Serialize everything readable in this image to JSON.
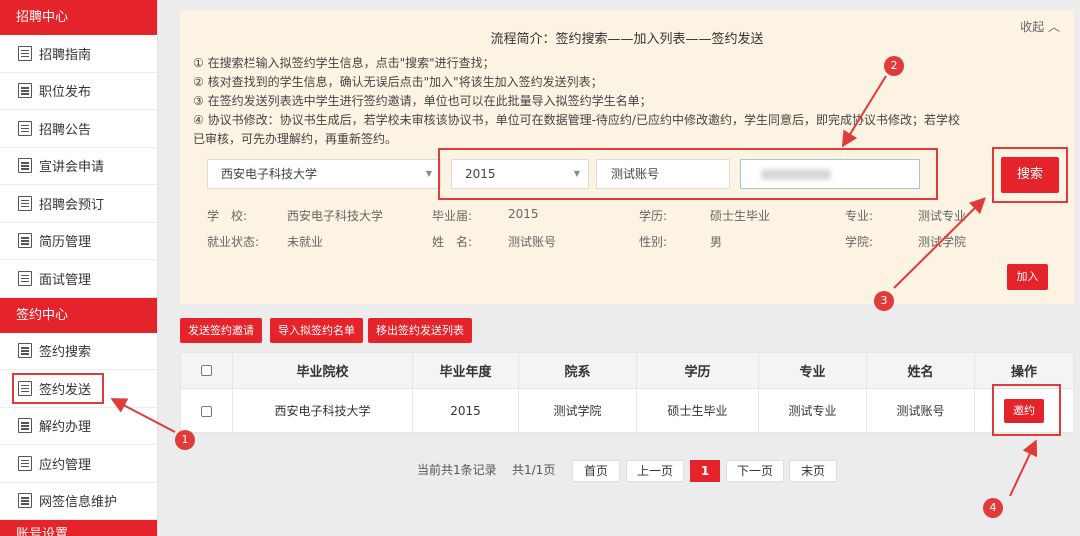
{
  "sidebar": {
    "section1": "招聘中心",
    "items1": [
      "招聘指南",
      "职位发布",
      "招聘公告",
      "宣讲会申请",
      "招聘会预订",
      "简历管理",
      "面试管理"
    ],
    "section2": "签约中心",
    "items2": [
      "签约搜索",
      "签约发送",
      "解约办理",
      "应约管理",
      "网签信息维护"
    ],
    "section3": "账号设置"
  },
  "info": {
    "title": "流程简介：签约搜索——加入列表——签约发送",
    "collapse": "收起 ︿",
    "steps": [
      "① 在搜索栏输入拟签约学生信息，点击\"搜索\"进行查找；",
      "② 核对查找到的学生信息，确认无误后点击\"加入\"将该生加入签约发送列表；",
      "③ 在签约发送列表选中学生进行签约邀请，单位也可以在此批量导入拟签约学生名单；",
      "④ 协议书修改：协议书生成后，若学校未审核该协议书，单位可在数据管理-待应约/已应约中修改邀约，学生同意后，即完成协议书修改；若学校",
      "已审核，可先办理解约，再重新签约。"
    ]
  },
  "search": {
    "school": "西安电子科技大学",
    "year": "2015",
    "account": "测试账号",
    "search_btn": "搜索",
    "add_btn": "加入"
  },
  "student": {
    "school_label": "学　校:",
    "school": "西安电子科技大学",
    "grad_label": "毕业届:",
    "grad": "2015",
    "degree_label": "学历:",
    "degree": "硕士生毕业",
    "major_label": "专业:",
    "major": "测试专业",
    "status_label": "就业状态:",
    "status": "未就业",
    "name_label": "姓　名:",
    "name": "测试账号",
    "gender_label": "性别:",
    "gender": "男",
    "college_label": "学院:",
    "college": "测试学院"
  },
  "actions": [
    "发送签约邀请",
    "导入拟签约名单",
    "移出签约发送列表"
  ],
  "table": {
    "headers": [
      "毕业院校",
      "毕业年度",
      "院系",
      "学历",
      "专业",
      "姓名",
      "操作"
    ],
    "row": [
      "西安电子科技大学",
      "2015",
      "测试学院",
      "硕士生毕业",
      "测试专业",
      "测试账号"
    ],
    "invite_btn": "邀约"
  },
  "pagination": {
    "summary": "当前共1条记录",
    "pages": "共1/1页",
    "first": "首页",
    "prev": "上一页",
    "current": "1",
    "next": "下一页",
    "last": "末页"
  },
  "annotations": [
    "1",
    "2",
    "3",
    "4"
  ],
  "colors": {
    "accent": "#e5232a",
    "panel": "#fdf3e2"
  }
}
